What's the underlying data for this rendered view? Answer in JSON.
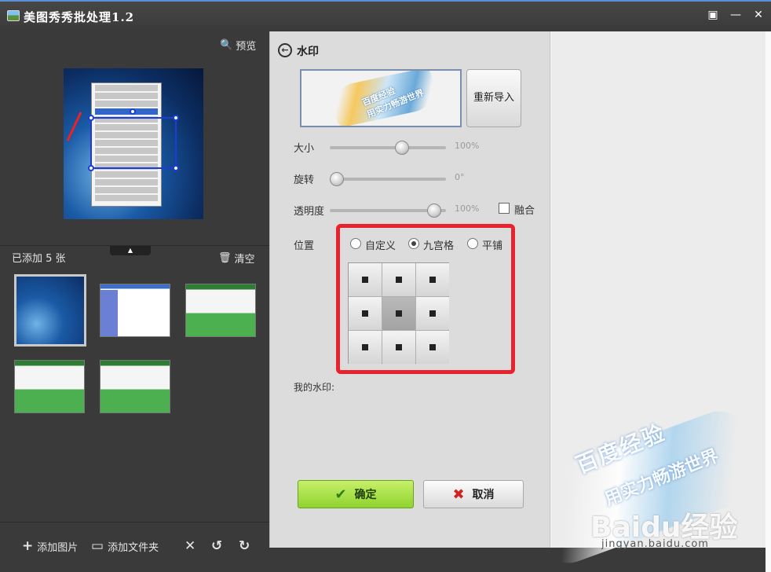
{
  "window": {
    "title": "美图秀秀批处理1.2"
  },
  "titlebar_buttons": [
    "feedback-icon",
    "minimize-icon",
    "close-icon"
  ],
  "left_panel": {
    "preview_label": "预览",
    "added_count": "已添加 5 张",
    "clear_label": "清空",
    "thumbnails": [
      {
        "kind": "blue",
        "selected": true
      },
      {
        "kind": "web",
        "selected": false
      },
      {
        "kind": "green",
        "selected": false
      },
      {
        "kind": "green",
        "selected": false
      },
      {
        "kind": "green",
        "selected": false
      }
    ],
    "bottom": {
      "add_image": "添加图片",
      "add_folder": "添加文件夹"
    }
  },
  "dialog": {
    "title": "水印",
    "reimport": "重新导入",
    "watermark_text": [
      "百度经验",
      "用实力畅游世界"
    ],
    "size": {
      "label": "大小",
      "value": "100%",
      "level": 0.64
    },
    "rotate": {
      "label": "旋转",
      "value": "0°",
      "level": 0.0
    },
    "opacity": {
      "label": "透明度",
      "value": "100%",
      "level": 0.95
    },
    "blend_label": "融合",
    "position": {
      "label": "位置",
      "options": [
        "自定义",
        "九宫格",
        "平铺"
      ],
      "selected": "九宫格",
      "active_cell": 4
    },
    "my_watermark": "我的水印:",
    "ok": "确定",
    "cancel": "取消"
  },
  "overlay_watermark": {
    "line1": "百度经验",
    "line2": "用实力畅游世界",
    "brand": "Baidu经验",
    "url": "jingyan.baidu.com"
  },
  "colors": {
    "highlight": "#e8232d",
    "ok": "#8fd32e",
    "titlebar_accent": "#5a8fd6"
  }
}
